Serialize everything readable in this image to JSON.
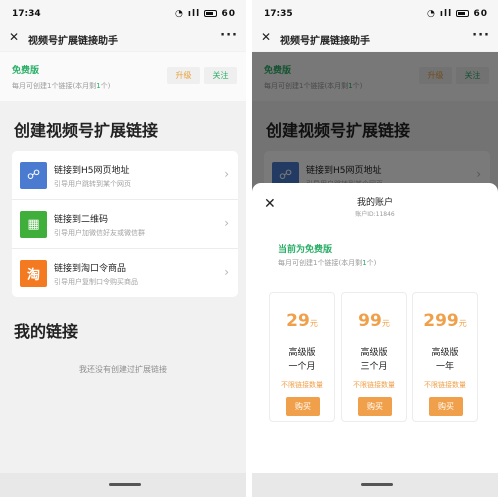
{
  "left": {
    "status_time": "17:34",
    "status_right": "⇅ 4G",
    "battery": "60",
    "nav_title": "视频号扩展链接助手",
    "plan": {
      "name": "免费版",
      "desc_prefix": "每月可创建1个链接(本月剩",
      "remaining": "1",
      "desc_suffix": "个)",
      "upgrade_label": "升级",
      "follow_label": "关注"
    },
    "create_title": "创建视频号扩展链接",
    "items": [
      {
        "label": "链接到H5网页地址",
        "sub": "引导用户跳转到某个网页",
        "icon": "link-icon",
        "color": "#4a7bd0",
        "glyph": "☍"
      },
      {
        "label": "链接到二维码",
        "sub": "引导用户加微信好友或微信群",
        "icon": "qrcode-icon",
        "color": "#3fae3a",
        "glyph": "▦"
      },
      {
        "label": "链接到淘口令商品",
        "sub": "引导用户复制口令购买商品",
        "icon": "taobao-icon",
        "color": "#f47a22",
        "glyph": "淘"
      }
    ],
    "my_links_title": "我的链接",
    "empty_text": "我还没有创建过扩展链接"
  },
  "right": {
    "status_time": "17:35",
    "sheet": {
      "title": "我的账户",
      "account_id": "账户ID:11846",
      "current_plan": "当前为免费版",
      "desc_prefix": "每月可创建1个链接(本月剩",
      "remaining": "1",
      "desc_suffix": "个)",
      "plans": [
        {
          "price": "29",
          "unit": "元",
          "tier": "高级版",
          "duration": "一个月",
          "feature": "不限链接数量",
          "buy_label": "购买"
        },
        {
          "price": "99",
          "unit": "元",
          "tier": "高级版",
          "duration": "三个月",
          "feature": "不限链接数量",
          "buy_label": "购买"
        },
        {
          "price": "299",
          "unit": "元",
          "tier": "高级版",
          "duration": "一年",
          "feature": "不限链接数量",
          "buy_label": "购买"
        }
      ]
    }
  },
  "colors": {
    "accent_green": "#2aae67",
    "accent_orange": "#f0a04a",
    "overlay": "rgba(0,0,0,0.52)"
  }
}
